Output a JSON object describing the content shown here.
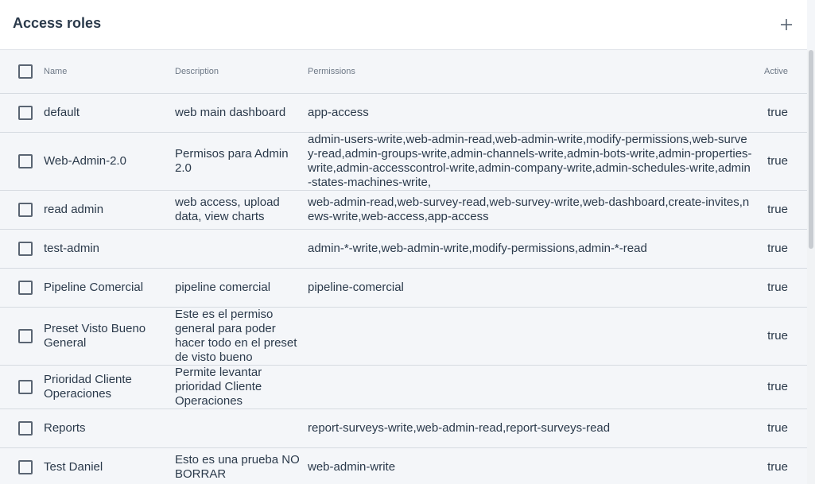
{
  "header": {
    "title": "Access roles",
    "add_icon": "plus-icon"
  },
  "table": {
    "columns": {
      "name": "Name",
      "description": "Description",
      "permissions": "Permissions",
      "active": "Active"
    },
    "rows": [
      {
        "name": "default",
        "description": "web main dashboard",
        "permissions": "app-access",
        "active": "true"
      },
      {
        "name": "Web-Admin-2.0",
        "description": "Permisos para Admin 2.0",
        "permissions": "admin-users-write,web-admin-read,web-admin-write,modify-permissions,web-survey-read,admin-groups-write,admin-channels-write,admin-bots-write,admin-properties-write,admin-accesscontrol-write,admin-company-write,admin-schedules-write,admin-states-machines-write,",
        "active": "true"
      },
      {
        "name": "read admin",
        "description": "web access, upload data, view charts",
        "permissions": "web-admin-read,web-survey-read,web-survey-write,web-dashboard,create-invites,news-write,web-access,app-access",
        "active": "true"
      },
      {
        "name": "test-admin",
        "description": "",
        "permissions": "admin-*-write,web-admin-write,modify-permissions,admin-*-read",
        "active": "true"
      },
      {
        "name": "Pipeline Comercial",
        "description": "pipeline comercial",
        "permissions": "pipeline-comercial",
        "active": "true"
      },
      {
        "name": "Preset Visto Bueno General",
        "description": "Este es el permiso general para poder hacer todo en el preset de visto bueno",
        "permissions": "",
        "active": "true"
      },
      {
        "name": "Prioridad Cliente Operaciones",
        "description": "Permite levantar prioridad Cliente Operaciones",
        "permissions": "",
        "active": "true"
      },
      {
        "name": "Reports",
        "description": "",
        "permissions": "report-surveys-write,web-admin-read,report-surveys-read",
        "active": "true"
      },
      {
        "name": "Test Daniel",
        "description": "Esto es una prueba NO BORRAR",
        "permissions": "web-admin-write",
        "active": "true"
      }
    ]
  },
  "colors": {
    "header_bg": "#ffffff",
    "page_bg": "#f4f6f9",
    "text": "#2b3a4b",
    "muted": "#6d7886",
    "divider": "#d6dbe1"
  }
}
